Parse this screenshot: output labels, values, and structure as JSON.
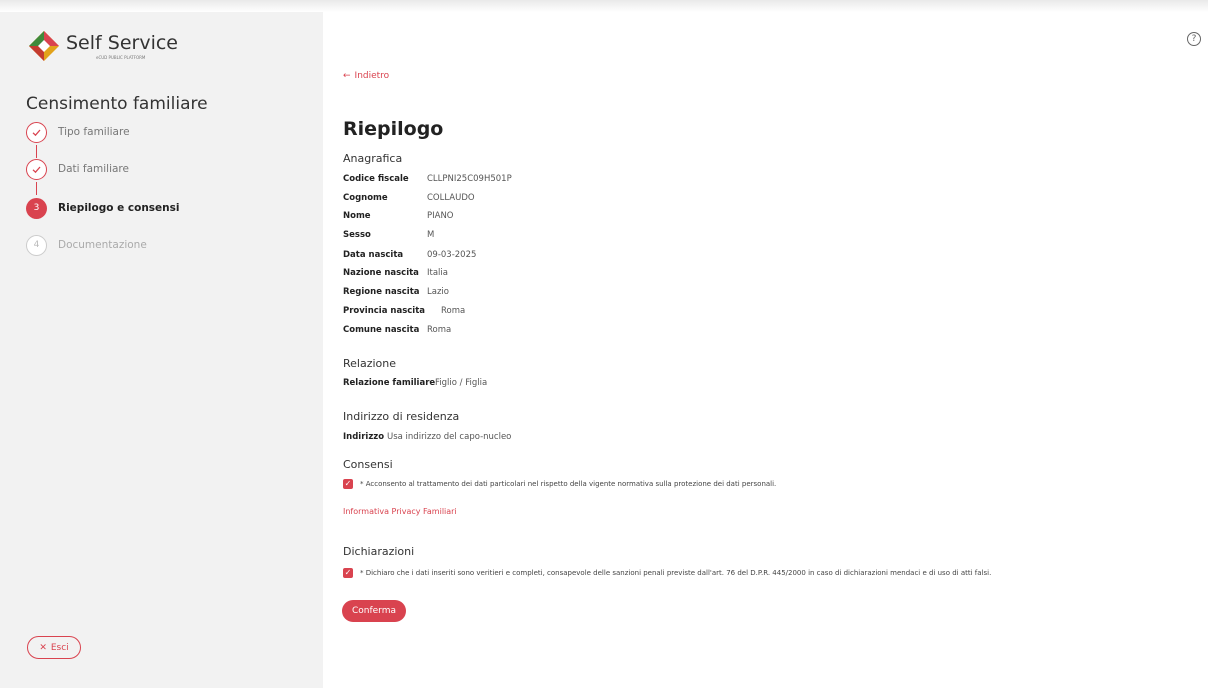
{
  "app": {
    "name": "Self Service",
    "subtitle": "eCUD PUBLIC PLATFORM"
  },
  "colors": {
    "accent": "#d9434f",
    "sidebar_bg": "#f2f2f2"
  },
  "sidebar": {
    "title": "Censimento familiare",
    "steps": [
      {
        "number": "1",
        "label": "Tipo familiare",
        "state": "done"
      },
      {
        "number": "2",
        "label": "Dati familiare",
        "state": "done"
      },
      {
        "number": "3",
        "label": "Riepilogo e consensi",
        "state": "active"
      },
      {
        "number": "4",
        "label": "Documentazione",
        "state": "todo"
      }
    ],
    "exit_label": "Esci",
    "exit_icon": "close-icon"
  },
  "header": {
    "help_icon": "question-circle-icon",
    "help_glyph": "?"
  },
  "main": {
    "back_label": "Indietro",
    "title": "Riepilogo",
    "anagrafica": {
      "title": "Anagrafica",
      "rows": [
        {
          "key": "Codice fiscale",
          "value": "CLLPNI25C09H501P"
        },
        {
          "key": "Cognome",
          "value": "COLLAUDO"
        },
        {
          "key": "Nome",
          "value": "PIANO"
        },
        {
          "key": "Sesso",
          "value": "M"
        },
        {
          "key": "Data nascita",
          "value": "09-03-2025"
        },
        {
          "key": "Nazione nascita",
          "value": "Italia"
        },
        {
          "key": "Regione nascita",
          "value": "Lazio"
        },
        {
          "key": "Provincia nascita",
          "value": "Roma"
        },
        {
          "key": "Comune nascita",
          "value": "Roma"
        }
      ]
    },
    "relazione": {
      "title": "Relazione",
      "key": "Relazione familiare",
      "value": "Figlio / Figlia"
    },
    "indirizzo": {
      "title": "Indirizzo di residenza",
      "key": "Indirizzo",
      "value": "Usa indirizzo del capo-nucleo"
    },
    "consensi": {
      "title": "Consensi",
      "checked": true,
      "text": "* Acconsento al trattamento dei dati particolari nel rispetto della vigente normativa sulla protezione dei dati personali.",
      "privacy_link": "Informativa Privacy Familiari"
    },
    "dichiarazioni": {
      "title": "Dichiarazioni",
      "checked": true,
      "text": "* Dichiaro che i dati inseriti sono veritieri e completi, consapevole delle sanzioni penali previste dall'art. 76 del D.P.R. 445/2000 in caso di dichiarazioni mendaci e di uso di atti falsi."
    },
    "confirm_label": "Conferma"
  }
}
